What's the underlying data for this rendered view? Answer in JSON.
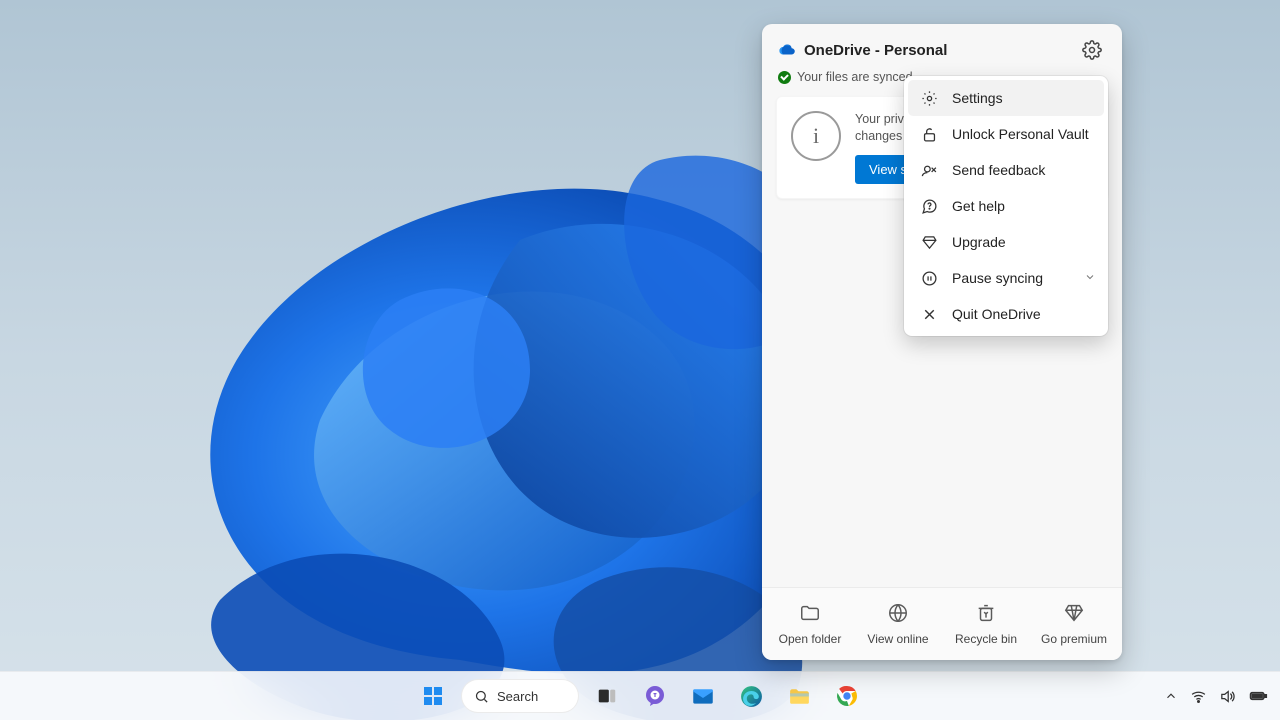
{
  "flyout": {
    "title": "OneDrive - Personal",
    "status_text": "Your files are synced",
    "notice_line1": "Your privacy settings were updated with",
    "notice_line2": "changes you should review.",
    "notice_button": "View settings",
    "footer": {
      "open_folder": "Open folder",
      "view_online": "View online",
      "recycle_bin": "Recycle bin",
      "go_premium": "Go premium"
    }
  },
  "menu": {
    "settings": "Settings",
    "unlock_vault": "Unlock Personal Vault",
    "send_feedback": "Send feedback",
    "get_help": "Get help",
    "upgrade": "Upgrade",
    "pause_syncing": "Pause syncing",
    "quit": "Quit OneDrive"
  },
  "taskbar": {
    "search": "Search"
  }
}
